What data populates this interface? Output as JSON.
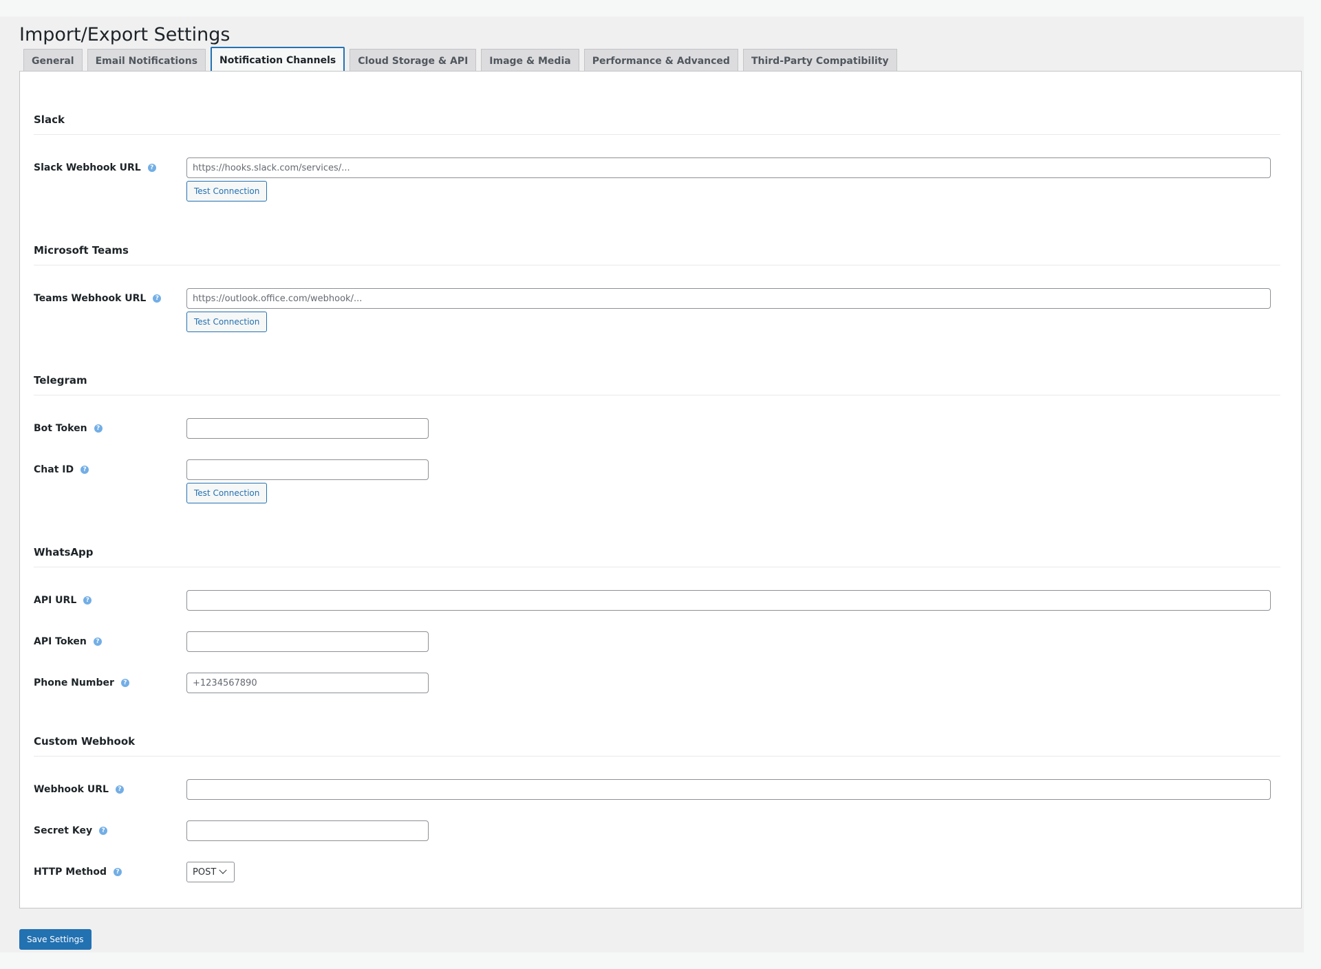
{
  "page": {
    "title": "Import/Export Settings"
  },
  "tabs": [
    {
      "label": "General",
      "active": false
    },
    {
      "label": "Email Notifications",
      "active": false
    },
    {
      "label": "Notification Channels",
      "active": true
    },
    {
      "label": "Cloud Storage & API",
      "active": false
    },
    {
      "label": "Image & Media",
      "active": false
    },
    {
      "label": "Performance & Advanced",
      "active": false
    },
    {
      "label": "Third-Party Compatibility",
      "active": false
    }
  ],
  "sections": {
    "slack": {
      "title": "Slack",
      "webhook_label": "Slack Webhook URL",
      "webhook_placeholder": "https://hooks.slack.com/services/...",
      "webhook_value": "",
      "test_label": "Test Connection"
    },
    "teams": {
      "title": "Microsoft Teams",
      "webhook_label": "Teams Webhook URL",
      "webhook_placeholder": "https://outlook.office.com/webhook/...",
      "webhook_value": "",
      "test_label": "Test Connection"
    },
    "telegram": {
      "title": "Telegram",
      "bot_token_label": "Bot Token",
      "bot_token_value": "",
      "chat_id_label": "Chat ID",
      "chat_id_value": "",
      "test_label": "Test Connection"
    },
    "whatsapp": {
      "title": "WhatsApp",
      "api_url_label": "API URL",
      "api_url_value": "",
      "api_token_label": "API Token",
      "api_token_value": "",
      "phone_label": "Phone Number",
      "phone_placeholder": "+1234567890",
      "phone_value": ""
    },
    "custom_webhook": {
      "title": "Custom Webhook",
      "url_label": "Webhook URL",
      "url_value": "",
      "secret_label": "Secret Key",
      "secret_value": "",
      "method_label": "HTTP Method",
      "method_selected": "POST"
    }
  },
  "footer": {
    "save_label": "Save Settings"
  },
  "icons": {
    "help": "help-icon",
    "dropdown": "chevron-down-icon"
  },
  "colors": {
    "accent": "#2271b1",
    "help_icon": "#72aee6",
    "background": "#f0f0f1",
    "panel": "#ffffff"
  }
}
